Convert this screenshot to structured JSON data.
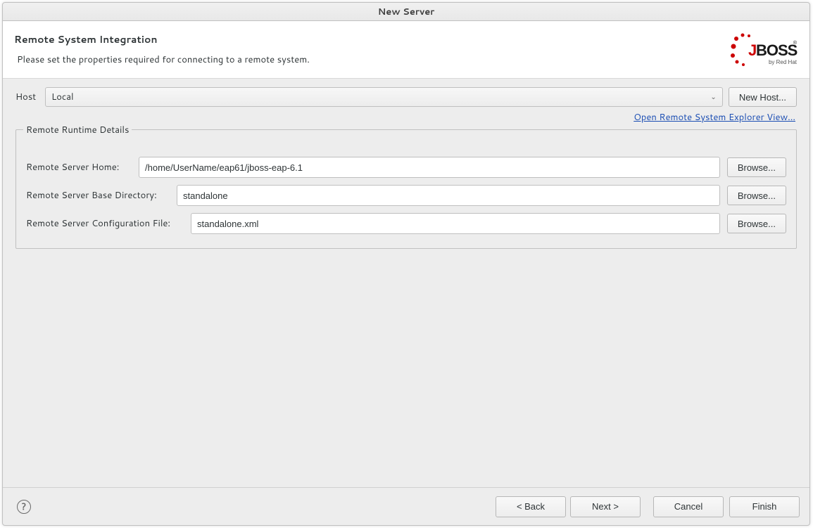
{
  "title": "New Server",
  "banner": {
    "title": "Remote System Integration",
    "description": "Please set the properties required for connecting to a remote system.",
    "logo_text_top": "JBoss",
    "logo_text_bottom": "by Red Hat"
  },
  "host": {
    "label": "Host",
    "value": "Local",
    "new_host_button": "New Host...",
    "link": "Open Remote System Explorer View..."
  },
  "fieldset": {
    "legend": "Remote Runtime Details",
    "home_label": "Remote Server Home:",
    "home_value": "/home/UserName/eap61/jboss-eap-6.1",
    "base_label": "Remote Server Base Directory:",
    "base_value": "standalone",
    "config_label": "Remote Server Configuration File:",
    "config_value": "standalone.xml",
    "browse": "Browse..."
  },
  "footer": {
    "back": "< Back",
    "next": "Next >",
    "cancel": "Cancel",
    "finish": "Finish"
  }
}
